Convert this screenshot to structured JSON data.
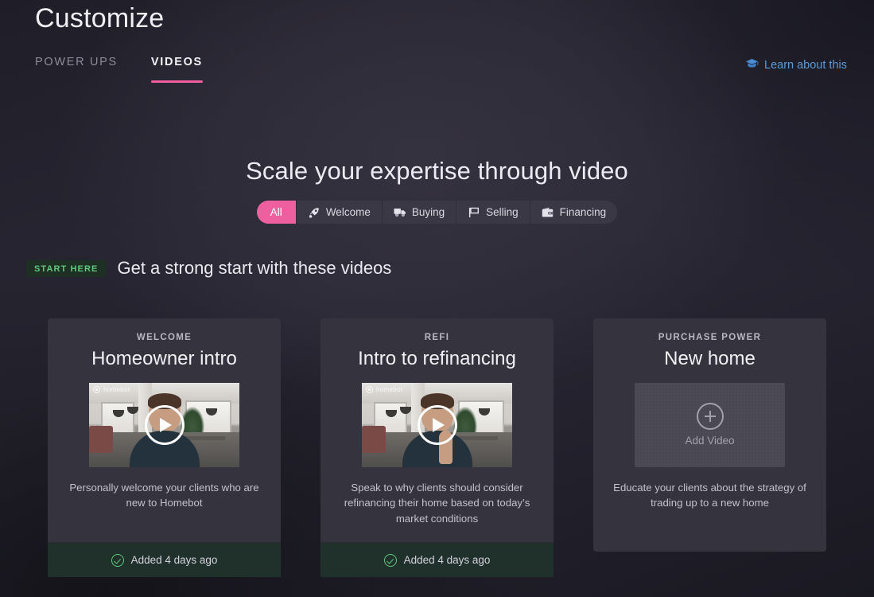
{
  "header": {
    "title": "Customize",
    "tabs": [
      {
        "label": "POWER UPS",
        "active": false
      },
      {
        "label": "VIDEOS",
        "active": true
      }
    ],
    "learn_link": {
      "label": "Learn about this",
      "icon": "graduation-cap-icon",
      "color": "#5b9bd8"
    }
  },
  "hero": {
    "title": "Scale your expertise through video",
    "filters": [
      {
        "label": "All",
        "icon": null,
        "active": true
      },
      {
        "label": "Welcome",
        "icon": "rocket-icon",
        "active": false
      },
      {
        "label": "Buying",
        "icon": "truck-icon",
        "active": false
      },
      {
        "label": "Selling",
        "icon": "flag-icon",
        "active": false
      },
      {
        "label": "Financing",
        "icon": "wallet-icon",
        "active": false
      }
    ]
  },
  "section": {
    "badge": "START HERE",
    "title": "Get a strong start with these videos"
  },
  "cards": [
    {
      "eyebrow": "WELCOME",
      "title": "Homeowner intro",
      "description": "Personally welcome your clients who are new to Homebot",
      "media_type": "video",
      "watermark": "homebot",
      "footer_status": "Added 4 days ago",
      "has_footer": true
    },
    {
      "eyebrow": "REFI",
      "title": "Intro to refinancing",
      "description": "Speak to why clients should consider refinancing their home based on today’s market conditions",
      "media_type": "video",
      "watermark": "homebot",
      "footer_status": "Added 4 days ago",
      "has_footer": true
    },
    {
      "eyebrow": "PURCHASE POWER",
      "title": "New home",
      "description": "Educate your clients about the strategy of trading up to a new home",
      "media_type": "placeholder",
      "add_label": "Add Video",
      "footer_status": null,
      "has_footer": false
    }
  ],
  "colors": {
    "accent_pink": "#ee5fa0",
    "link_blue": "#5b9bd8",
    "status_green": "#5fc97e",
    "card_bg": "#35333e",
    "footer_bg": "#20302a"
  }
}
